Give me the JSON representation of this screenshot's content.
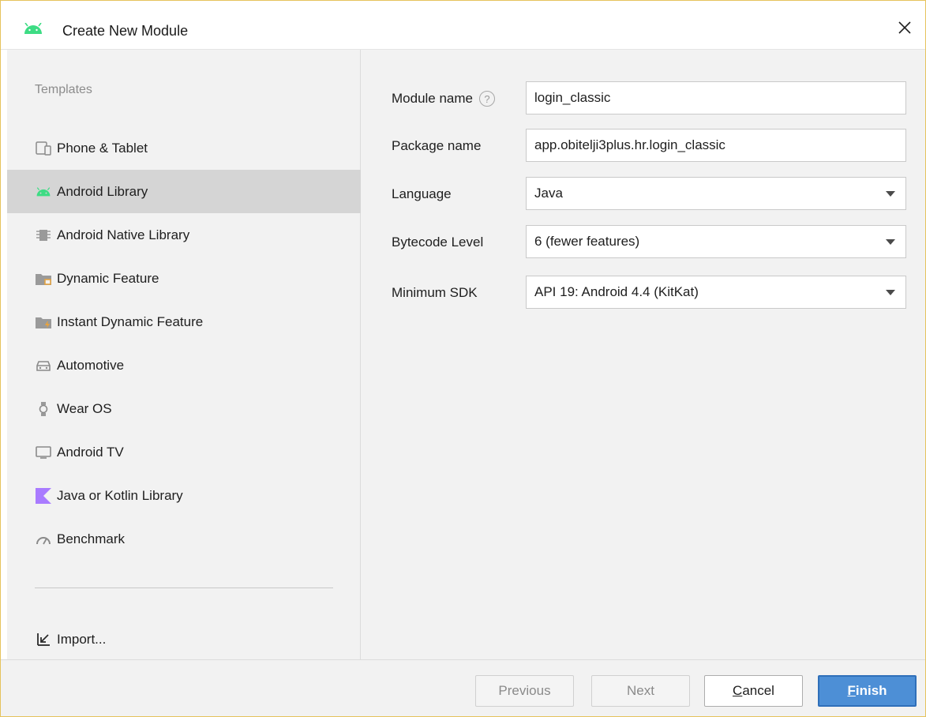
{
  "window": {
    "title": "Create New Module"
  },
  "sidebar": {
    "section_label": "Templates",
    "items": [
      {
        "label": "Phone & Tablet",
        "icon": "phone-tablet-icon",
        "selected": false
      },
      {
        "label": "Android Library",
        "icon": "android-icon",
        "selected": true
      },
      {
        "label": "Android Native Library",
        "icon": "native-chip-icon",
        "selected": false
      },
      {
        "label": "Dynamic Feature",
        "icon": "dynamic-feature-folder-icon",
        "selected": false
      },
      {
        "label": "Instant Dynamic Feature",
        "icon": "instant-feature-folder-icon",
        "selected": false
      },
      {
        "label": "Automotive",
        "icon": "car-icon",
        "selected": false
      },
      {
        "label": "Wear OS",
        "icon": "watch-icon",
        "selected": false
      },
      {
        "label": "Android TV",
        "icon": "tv-icon",
        "selected": false
      },
      {
        "label": "Java or Kotlin Library",
        "icon": "kotlin-icon",
        "selected": false
      },
      {
        "label": "Benchmark",
        "icon": "gauge-icon",
        "selected": false
      }
    ],
    "import_label": "Import..."
  },
  "form": {
    "module_name": {
      "label": "Module name",
      "value": "login_classic",
      "help": "?"
    },
    "package_name": {
      "label": "Package name",
      "value": "app.obitelji3plus.hr.login_classic"
    },
    "language": {
      "label": "Language",
      "value": "Java"
    },
    "bytecode_level": {
      "label": "Bytecode Level",
      "value": "6 (fewer features)"
    },
    "minimum_sdk": {
      "label": "Minimum SDK",
      "value": "API 19: Android 4.4 (KitKat)"
    }
  },
  "footer": {
    "previous": "Previous",
    "next": "Next",
    "cancel_first": "C",
    "cancel_rest": "ancel",
    "finish_first": "F",
    "finish_rest": "inish"
  },
  "colors": {
    "accent": "#4d8fd6",
    "android_green": "#3ddc84",
    "kotlin_purple": "#a97bff",
    "selected_bg": "#d5d5d5"
  }
}
